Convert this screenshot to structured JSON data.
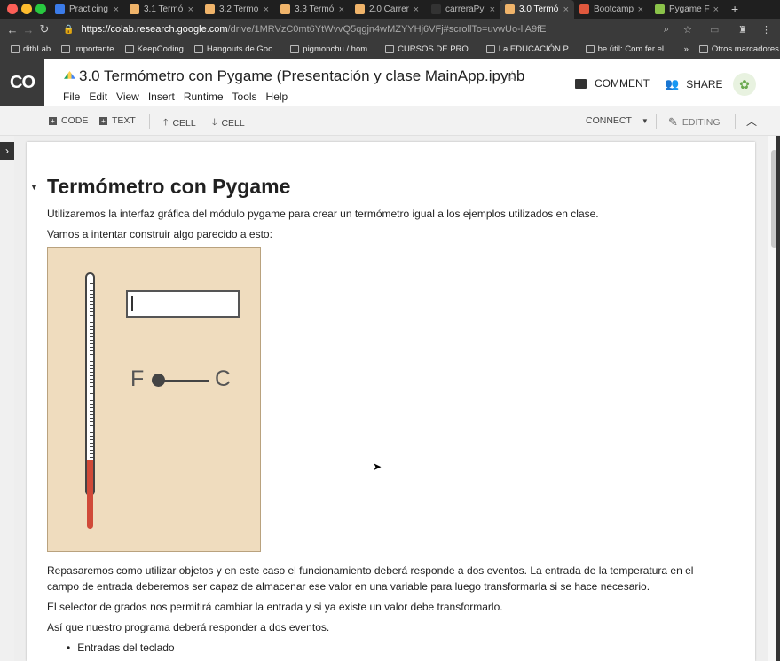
{
  "browser": {
    "tabs": [
      {
        "label": "Practicing",
        "color": "#3b7be8"
      },
      {
        "label": "3.1 Termó",
        "color": "#f0b46a"
      },
      {
        "label": "3.2 Termo",
        "color": "#f0b46a"
      },
      {
        "label": "3.3 Termó",
        "color": "#f0b46a"
      },
      {
        "label": "2.0 Carrer",
        "color": "#f0b46a"
      },
      {
        "label": "carreraPy",
        "color": "#333333"
      },
      {
        "label": "3.0 Termó",
        "color": "#f0b46a"
      },
      {
        "label": "Bootcamp",
        "color": "#e0583d"
      },
      {
        "label": "Pygame F",
        "color": "#8bc34a"
      }
    ],
    "url_host": "https://colab.research.google.com",
    "url_path": "/drive/1MRVzC0mt6YtWvvQ5qgjn4wMZYYHj6VFj#scrollTo=uvwUo-liA9fE",
    "bookmarks": [
      "dithLab",
      "Importante",
      "KeepCoding",
      "Hangouts de Goo...",
      "pigmonchu / hom...",
      "CURSOS DE PRO...",
      "La EDUCACIÓN P...",
      "be útil: Com fer el ...",
      "»",
      "Otros marcadores"
    ]
  },
  "colab": {
    "logo": "CO",
    "title": "3.0 Termómetro con Pygame (Presentación y clase MainApp.ipynb",
    "menu": [
      "File",
      "Edit",
      "View",
      "Insert",
      "Runtime",
      "Tools",
      "Help"
    ],
    "comment_label": "COMMENT",
    "share_label": "SHARE",
    "toolbar": {
      "code": "CODE",
      "text": "TEXT",
      "cell_up": "CELL",
      "cell_down": "CELL",
      "connect": "CONNECT",
      "editing": "EDITING"
    }
  },
  "notebook": {
    "heading": "Termómetro con Pygame",
    "p1": "Utilizaremos la interfaz gráfica del módulo pygame para crear un termómetro igual a los ejemplos utilizados en clase.",
    "p2": "Vamos a intentar construir algo parecido a esto:",
    "fig_f": "F",
    "fig_c": "C",
    "p3a": "Repasaremos como utilizar objetos y en este caso el funcionamiento deberá responde a dos eventos. La entrada de la temperatura en el",
    "p3b": "campo de entrada deberemos ser capaz de almacenar ese valor en una variable para luego transformarla si se hace necesario.",
    "p4": "El selector de grados nos permitirá cambiar la entrada y si ya existe un valor debe transformarlo.",
    "p5": "Así que nuestro programa deberá responder a dos eventos.",
    "li1": "Entradas del teclado"
  },
  "icons": {
    "star": "star-icon",
    "comment": "comment-icon",
    "share": "people-icon",
    "edit": "pencil-icon"
  }
}
